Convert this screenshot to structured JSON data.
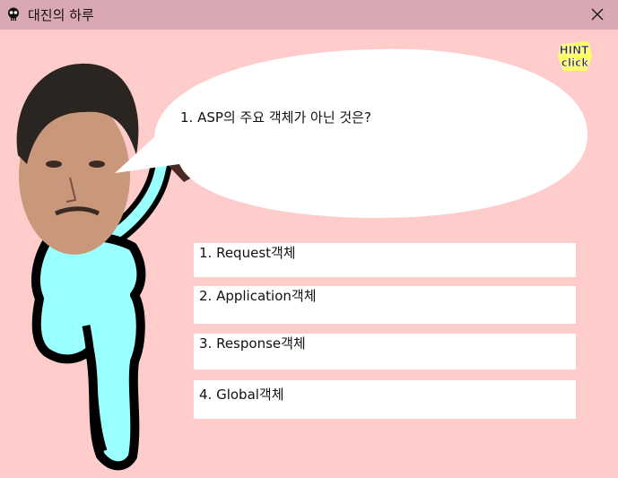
{
  "window": {
    "title": "대진의 하루",
    "close_icon": "close-icon",
    "app_icon": "skull-icon"
  },
  "quiz": {
    "question": "1. ASP의 주요 객체가 아닌 것은?",
    "hint": {
      "line1": "HINT",
      "line2": "click"
    },
    "answers": [
      "1. Request객체",
      "2. Application객체",
      "3. Response객체",
      "4. Global객체"
    ]
  },
  "colors": {
    "background": "#ffcccc",
    "titlebar": "#d9a8b2",
    "body": "#99ffff",
    "answer_box": "#ffffff"
  }
}
